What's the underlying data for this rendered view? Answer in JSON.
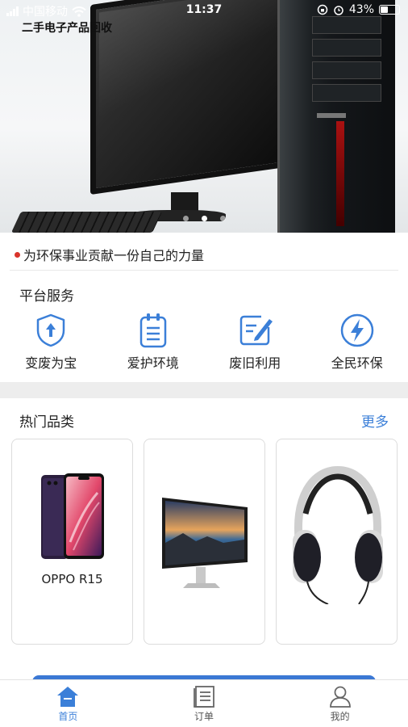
{
  "status_bar": {
    "carrier": "中国移动",
    "time": "11:37",
    "battery": "43%",
    "battery_level": 0.43
  },
  "banner": {
    "title": "二手电子产品回收",
    "slide_count": 3,
    "active_slide": 1
  },
  "notice": {
    "text": "为环保事业贡献一份自己的力量"
  },
  "services": {
    "title": "平台服务",
    "items": [
      {
        "label": "变废为宝",
        "icon": "shield-icon"
      },
      {
        "label": "爱护环境",
        "icon": "clipboard-icon"
      },
      {
        "label": "废旧利用",
        "icon": "edit-icon"
      },
      {
        "label": "全民环保",
        "icon": "lightning-icon"
      }
    ]
  },
  "categories": {
    "title": "热门品类",
    "more_label": "更多",
    "items": [
      {
        "name": "OPPO R15",
        "image": "phone-image"
      },
      {
        "name": "",
        "image": "monitor-image"
      },
      {
        "name": "",
        "image": "headphones-image"
      }
    ]
  },
  "tabbar": {
    "items": [
      {
        "label": "首页",
        "icon": "home-icon",
        "active": true
      },
      {
        "label": "订单",
        "icon": "order-list-icon",
        "active": false
      },
      {
        "label": "我的",
        "icon": "user-icon",
        "active": false
      }
    ]
  },
  "colors": {
    "accent": "#3b7fd8",
    "notice_dot": "#d9342b"
  }
}
